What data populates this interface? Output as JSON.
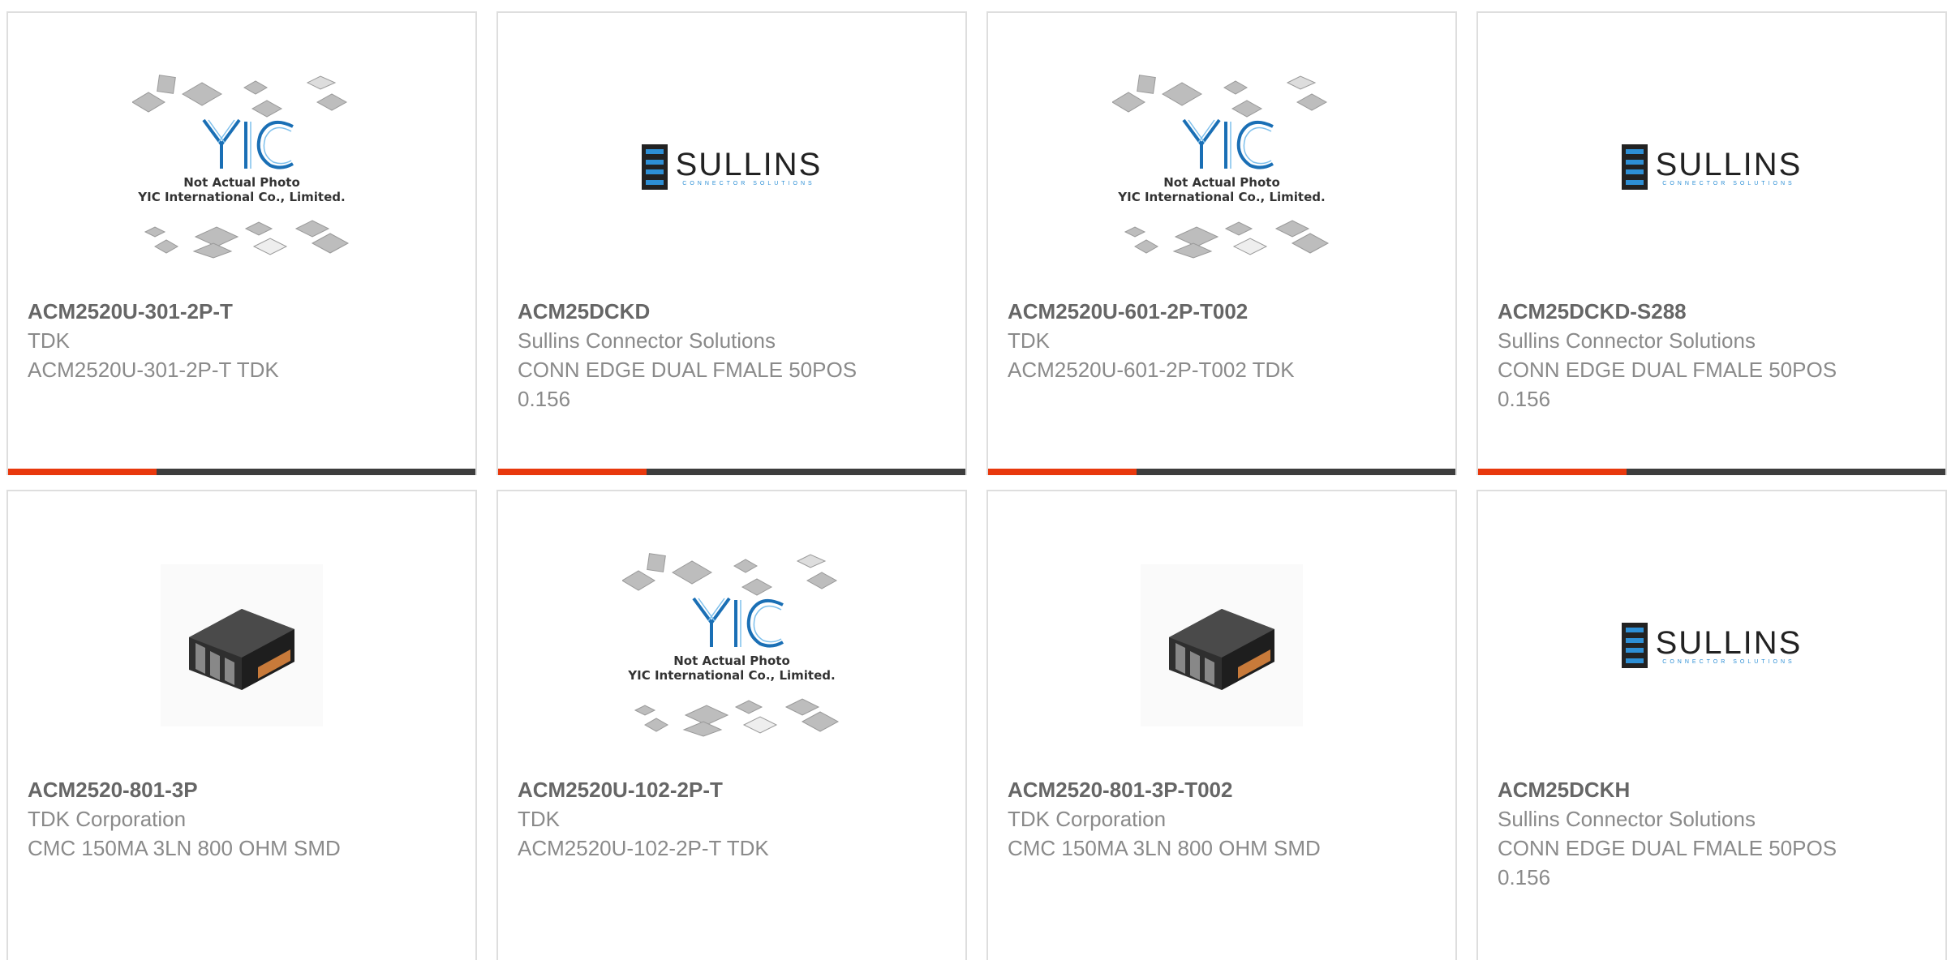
{
  "products": [
    {
      "part_number": "ACM2520U-301-2P-T",
      "manufacturer": "TDK",
      "description": "ACM2520U-301-2P-T TDK",
      "image": "yic-placeholder"
    },
    {
      "part_number": "ACM25DCKD",
      "manufacturer": "Sullins Connector Solutions",
      "description": "CONN EDGE DUAL FMALE 50POS 0.156",
      "image": "sullins-logo"
    },
    {
      "part_number": "ACM2520U-601-2P-T002",
      "manufacturer": "TDK",
      "description": "ACM2520U-601-2P-T002 TDK",
      "image": "yic-placeholder"
    },
    {
      "part_number": "ACM25DCKD-S288",
      "manufacturer": "Sullins Connector Solutions",
      "description": "CONN EDGE DUAL FMALE 50POS 0.156",
      "image": "sullins-logo"
    },
    {
      "part_number": "ACM2520-801-3P",
      "manufacturer": "TDK Corporation",
      "description": "CMC 150MA 3LN 800 OHM SMD",
      "image": "inductor-photo"
    },
    {
      "part_number": "ACM2520U-102-2P-T",
      "manufacturer": "TDK",
      "description": "ACM2520U-102-2P-T TDK",
      "image": "yic-placeholder"
    },
    {
      "part_number": "ACM2520-801-3P-T002",
      "manufacturer": "TDK Corporation",
      "description": "CMC 150MA 3LN 800 OHM SMD",
      "image": "inductor-photo"
    },
    {
      "part_number": "ACM25DCKH",
      "manufacturer": "Sullins Connector Solutions",
      "description": "CONN EDGE DUAL FMALE 50POS 0.156",
      "image": "sullins-logo"
    }
  ],
  "logos": {
    "sullins_name": "SULLINS",
    "sullins_tagline": "CONNECTOR SOLUTIONS",
    "yic_mark": "YIC",
    "yic_line1": "Not Actual Photo",
    "yic_line2": "YIC International Co., Limited."
  },
  "colors": {
    "accent": "#e8380d",
    "bar": "#3d3d3d",
    "border": "#dedede",
    "sullins_blue": "#2d8fd5",
    "yic_blue": "#1a6fb5"
  }
}
